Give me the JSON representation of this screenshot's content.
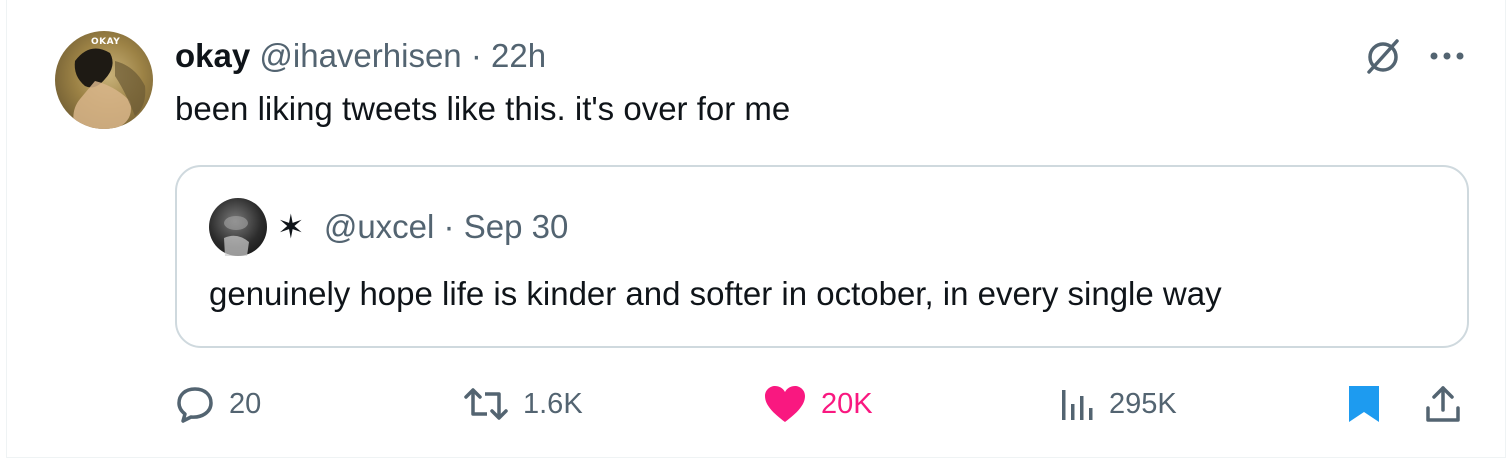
{
  "tweet": {
    "avatar_tag": "OKAY",
    "display_name": "okay",
    "handle": "@ihaverhisen",
    "separator": "·",
    "time": "22h",
    "text": "been liking tweets like this. it's over for me"
  },
  "quote": {
    "display_name": "✶",
    "handle": "@uxcel",
    "separator": "·",
    "time": "Sep 30",
    "text": "genuinely hope life is kinder and softer in october, in every single way"
  },
  "actions": {
    "replies": "20",
    "retweets": "1.6K",
    "likes": "20K",
    "views": "295K"
  },
  "icons": {
    "grok": "grok-icon",
    "more": "more-icon",
    "reply": "reply-icon",
    "retweet": "retweet-icon",
    "like": "heart-icon",
    "views": "views-icon",
    "bookmark": "bookmark-icon",
    "share": "share-icon"
  },
  "colors": {
    "text": "#0f1419",
    "secondary": "#536471",
    "like": "#f91880",
    "bookmark": "#1d9bf0",
    "border": "#cfd9de"
  }
}
